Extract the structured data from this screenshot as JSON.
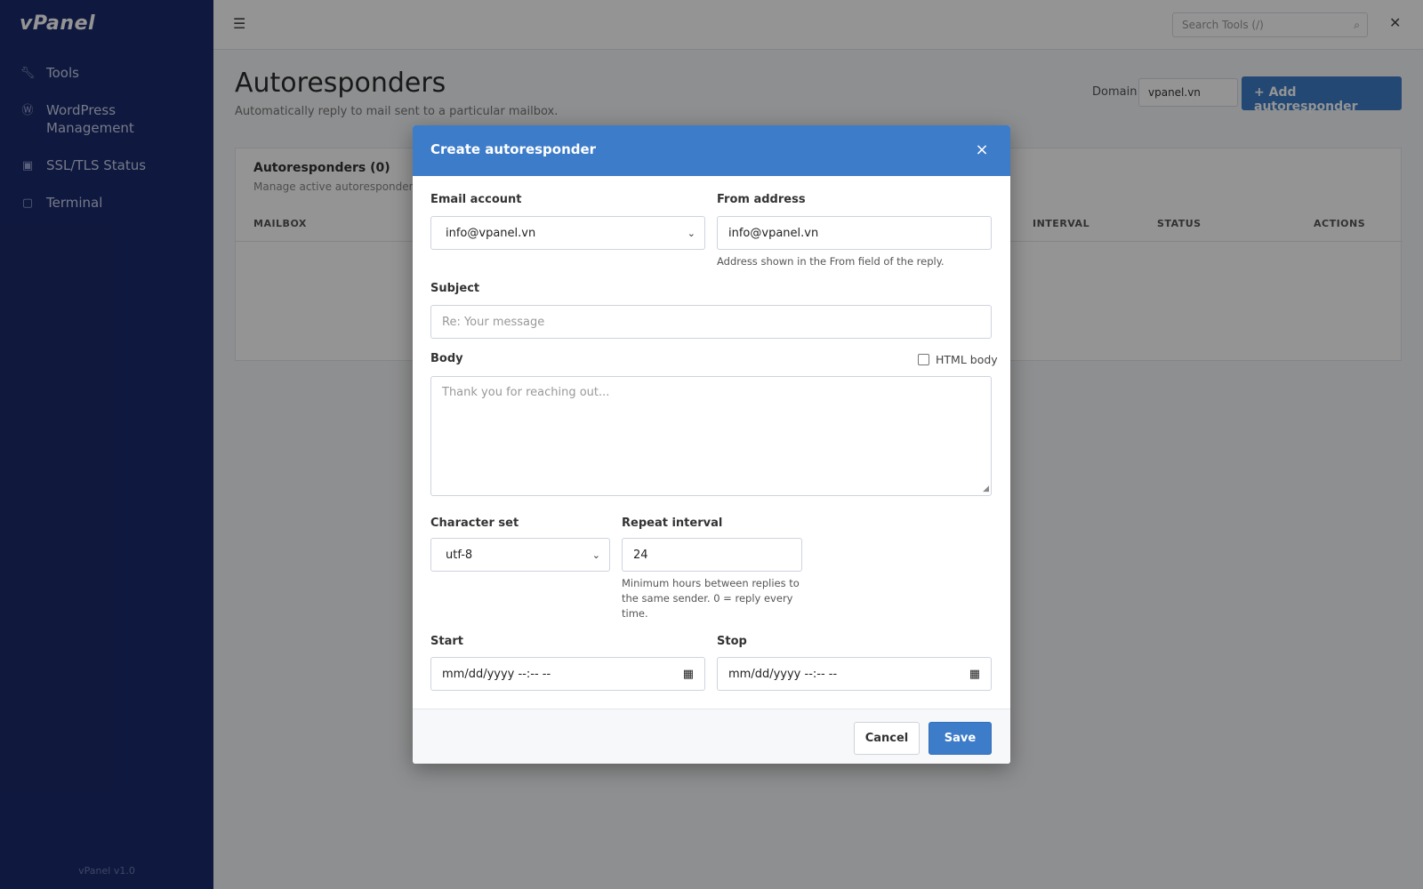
{
  "app": {
    "logo": "vPanel",
    "sidebar_footer": "vPanel v1.0"
  },
  "sidebar": {
    "items": [
      {
        "label": "Tools",
        "icon": "wrench-icon"
      },
      {
        "label": "WordPress Management",
        "icon": "wordpress-icon"
      },
      {
        "label": "SSL/TLS Status",
        "icon": "lock-icon"
      },
      {
        "label": "Terminal",
        "icon": "terminal-icon"
      }
    ]
  },
  "topbar": {
    "search_placeholder": "Search Tools (/)"
  },
  "page": {
    "title": "Autoresponders",
    "subtitle": "Automatically reply to mail sent to a particular mailbox.",
    "domain_label": "Domain",
    "domain_value": "vpanel.vn",
    "add_button": "Add autoresponder"
  },
  "card": {
    "title": "Autoresponders (0)",
    "subtitle": "Manage active autoresponders",
    "columns": [
      "Mailbox",
      "Interval",
      "Status",
      "Actions"
    ]
  },
  "modal": {
    "title": "Create autoresponder",
    "close_glyph": "×",
    "email_account_label": "Email account",
    "email_account_value": "info@vpanel.vn",
    "from_address_label": "From address",
    "from_address_value": "info@vpanel.vn",
    "from_address_help": "Address shown in the From field of the reply.",
    "subject_label": "Subject",
    "subject_placeholder": "Re: Your message",
    "body_label": "Body",
    "html_body_label": "HTML body",
    "body_placeholder": "Thank you for reaching out...",
    "charset_label": "Character set",
    "charset_value": "utf-8",
    "interval_label": "Repeat interval",
    "interval_value": "24",
    "interval_help": "Minimum hours between replies to the same sender. 0 = reply every time.",
    "start_label": "Start",
    "start_placeholder": "mm/dd/yyyy --:-- --",
    "stop_label": "Stop",
    "stop_placeholder": "mm/dd/yyyy --:-- --",
    "cancel_label": "Cancel",
    "save_label": "Save"
  },
  "colors": {
    "sidebar_bg": "#1b2a6b",
    "accent": "#3d7cc9"
  }
}
